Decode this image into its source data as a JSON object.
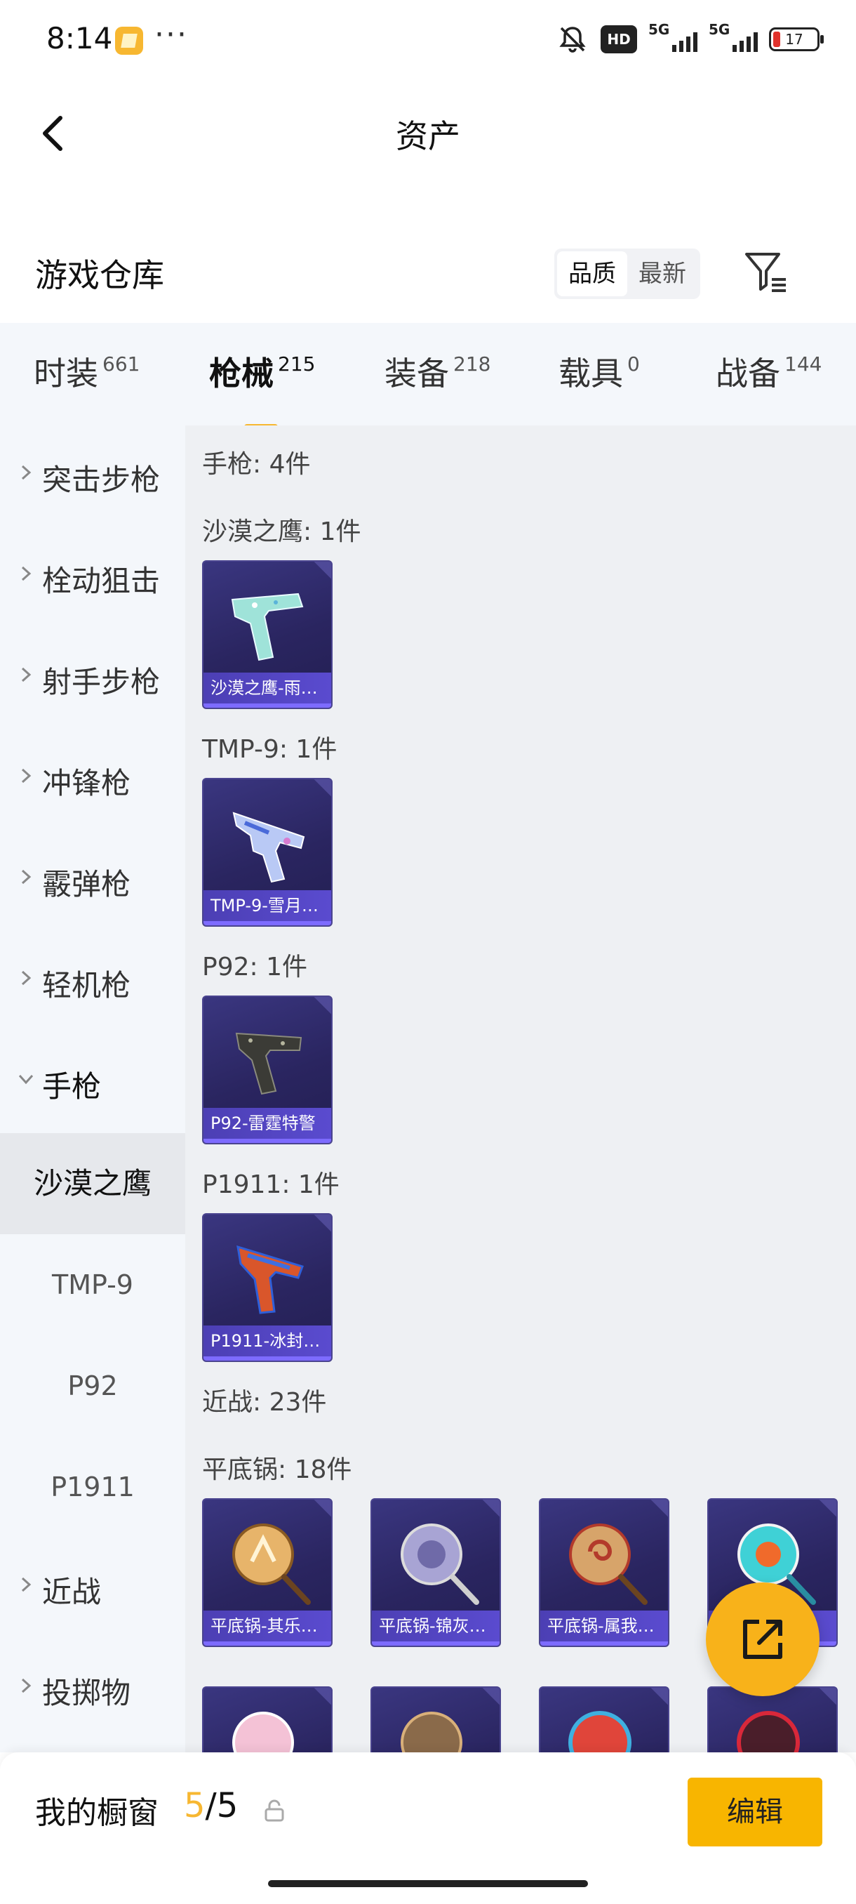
{
  "status_bar": {
    "time": "8:14",
    "dots": "···",
    "hd": "HD",
    "sim1": "5G",
    "sim2": "5G",
    "battery": "17",
    "icons": [
      "gallery-notification-icon",
      "mute-icon",
      "hd-icon",
      "signal-icon",
      "signal-icon",
      "battery-icon"
    ]
  },
  "nav": {
    "title": "资产",
    "back_icon": "chevron-left-icon"
  },
  "warehouse": {
    "label": "游戏仓库",
    "sort_options": [
      "品质",
      "最新"
    ],
    "sort_selected": "品质",
    "filter_icon": "filter-list-icon"
  },
  "tabs": [
    {
      "name": "时装",
      "count": "661"
    },
    {
      "name": "枪械",
      "count": "215",
      "active": true
    },
    {
      "name": "装备",
      "count": "218"
    },
    {
      "name": "载具",
      "count": "0"
    },
    {
      "name": "战备",
      "count": "144"
    }
  ],
  "sidebar": {
    "items": [
      {
        "label": "突击步枪"
      },
      {
        "label": "栓动狙击"
      },
      {
        "label": "射手步枪"
      },
      {
        "label": "冲锋枪"
      },
      {
        "label": "霰弹枪"
      },
      {
        "label": "轻机枪"
      },
      {
        "label": "手枪",
        "expanded": true
      }
    ],
    "sub_items": [
      {
        "label": "沙漠之鹰",
        "selected": true
      },
      {
        "label": "TMP-9"
      },
      {
        "label": "P92"
      },
      {
        "label": "P1911"
      }
    ],
    "tail_items": [
      {
        "label": "近战"
      },
      {
        "label": "投掷物"
      }
    ]
  },
  "content": {
    "pistol_group": "手枪: 4件",
    "pistol_sections": [
      {
        "title": "沙漠之鹰: 1件",
        "item": "沙漠之鹰-雨…"
      },
      {
        "title": "TMP-9: 1件",
        "item": "TMP-9-雪月…"
      },
      {
        "title": "P92: 1件",
        "item": "P92-雷霆特警"
      },
      {
        "title": "P1911: 1件",
        "item": "P1911-冰封…"
      }
    ],
    "melee_group": "近战: 23件",
    "pan_section": "平底锅: 18件",
    "pan_items": [
      "平底锅-其乐…",
      "平底锅-锦灰…",
      "平底锅-属我…",
      ""
    ]
  },
  "fab_icon": "share-external-icon",
  "bottom": {
    "label": "我的橱窗",
    "current": "5",
    "separator": "/",
    "total": "5",
    "lock_icon": "lock-icon",
    "edit": "编辑"
  },
  "colors": {
    "accent": "#f7b731",
    "card": "#2a2560",
    "caption": "#5a4bcf"
  }
}
